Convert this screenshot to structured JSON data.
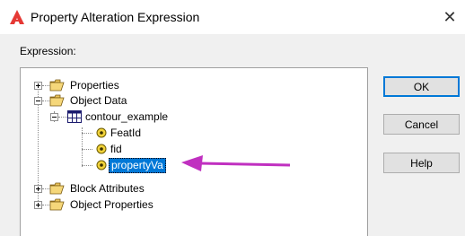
{
  "window": {
    "title": "Property Alteration Expression",
    "close_glyph": "✕"
  },
  "expression": {
    "label": "Expression:"
  },
  "tree": {
    "properties": "Properties",
    "object_data": "Object Data",
    "table": "contour_example",
    "fields": [
      "FeatId",
      "fid",
      "propertyVa"
    ],
    "block_attributes": "Block Attributes",
    "object_properties": "Object Properties"
  },
  "buttons": {
    "ok": "OK",
    "cancel": "Cancel",
    "help": "Help"
  },
  "colors": {
    "selection": "#0078d7",
    "arrow": "#c030c0",
    "app_icon": "#e53935"
  },
  "icons": {
    "app": "autocad-icon",
    "folder": "open-folder-icon",
    "table": "table-icon",
    "field": "field-icon"
  }
}
